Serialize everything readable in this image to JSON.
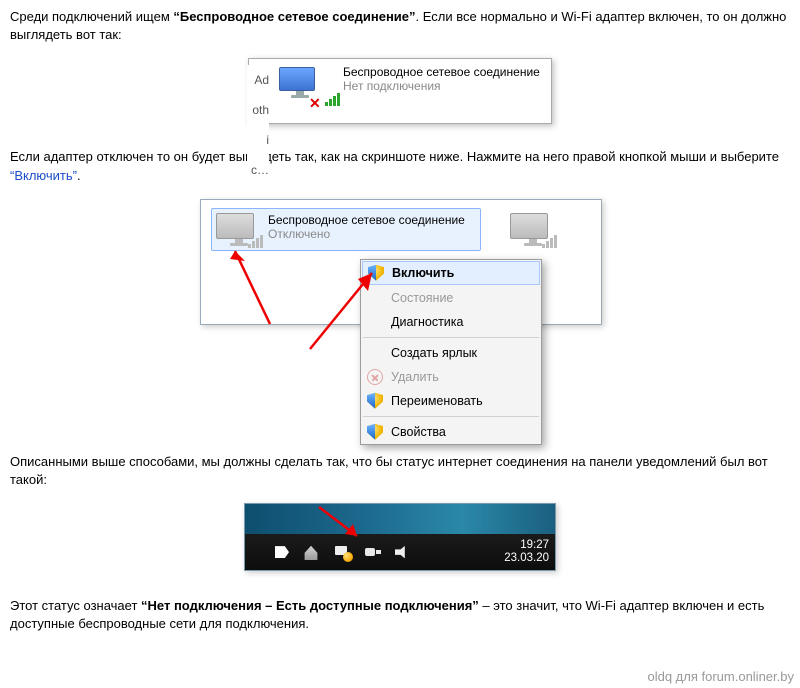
{
  "p1_a": "Среди подключений ищем ",
  "p1_bold": "“Беспроводное сетевое соединение”",
  "p1_b": ". Если все нормально и Wi-Fi адаптер включен, то он должно выглядеть вот так:",
  "fig1": {
    "side_a": "Ad",
    "side_b": "oth",
    "side_c": "i c…",
    "title": "Беспроводное сетевое соединение",
    "status": "Нет подключения"
  },
  "p2_a": "Если адаптер отключен то он будет выглядеть так, как на скриншоте ниже. Нажмите на него правой кнопкой мыши и выберите ",
  "p2_link": "“Включить”",
  "p2_b": ".",
  "fig2": {
    "title": "Беспроводное сетевое соединение",
    "status": "Отключено",
    "menu": {
      "enable": "Включить",
      "state": "Состояние",
      "diag": "Диагностика",
      "shortcut": "Создать ярлык",
      "delete": "Удалить",
      "rename": "Переименовать",
      "props": "Свойства"
    }
  },
  "p3": "Описанными выше способами,  мы должны сделать так, что бы статус интернет соединения на панели уведомлений был вот такой:",
  "fig3": {
    "time": "19:27",
    "date": "23.03.20"
  },
  "p4_a": "Этот статус означает ",
  "p4_bold": "“Нет подключения – Есть доступные подключения”",
  "p4_b": " – это значит, что Wi-Fi адаптер включен и есть доступные беспроводные сети для подключения.",
  "watermark": "oldq для forum.onliner.by"
}
